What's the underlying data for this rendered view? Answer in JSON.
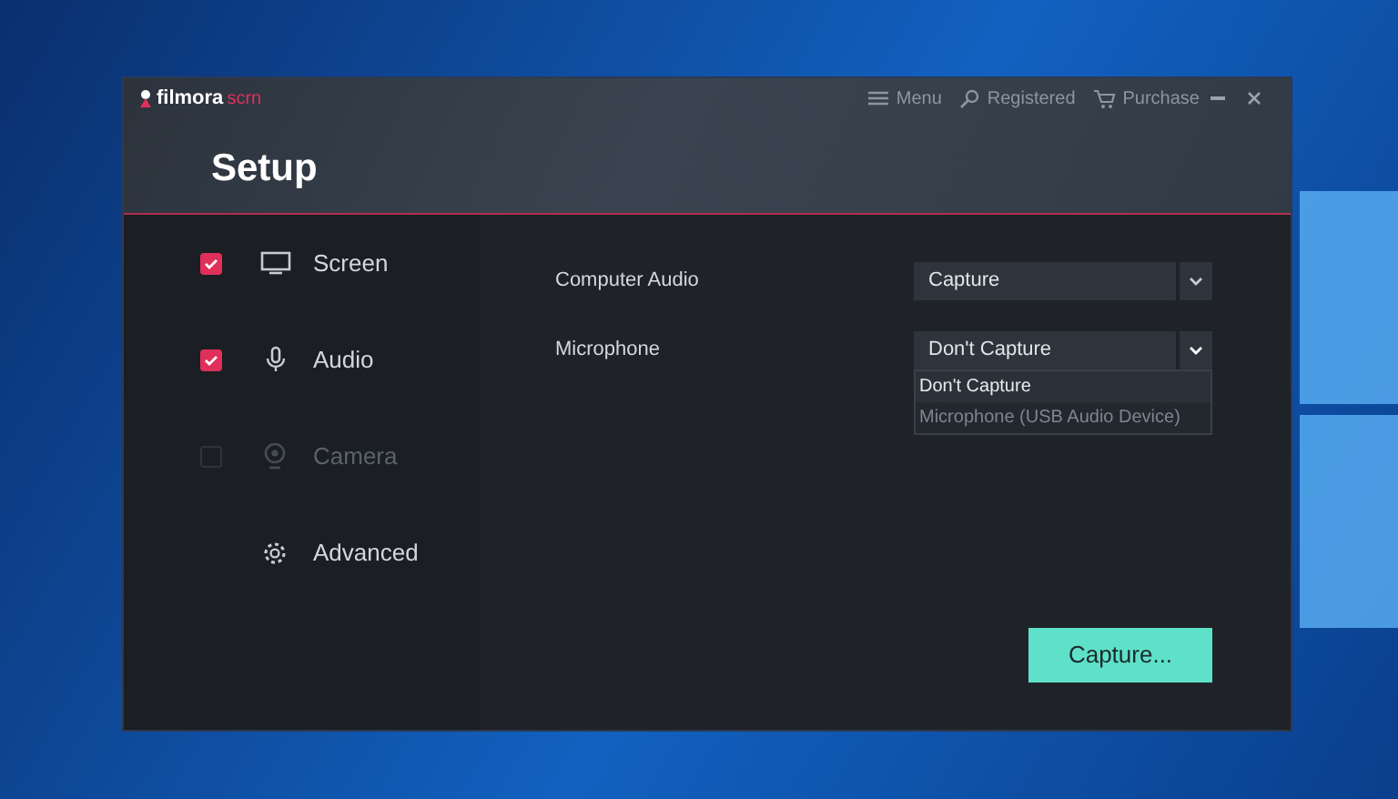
{
  "window": {
    "logo": "filmora",
    "logo_suffix": "scrn",
    "title": "Setup"
  },
  "header_actions": [
    {
      "kind": "menu",
      "label": "Menu"
    },
    {
      "kind": "key",
      "label": "Registered"
    },
    {
      "kind": "cart",
      "label": "Purchase"
    }
  ],
  "sidebar": {
    "items": [
      {
        "kind": "screen",
        "label": "Screen",
        "checked": true,
        "disabled": false
      },
      {
        "kind": "audio",
        "label": "Audio",
        "checked": true,
        "disabled": false
      },
      {
        "kind": "camera",
        "label": "Camera",
        "checked": false,
        "disabled": true
      },
      {
        "kind": "advanced",
        "label": "Advanced",
        "disabled": false
      }
    ]
  },
  "settings": [
    {
      "label": "Computer Audio",
      "value": "Capture",
      "expanded": false
    },
    {
      "label": "Microphone",
      "value": "Don't Capture",
      "expanded": true,
      "options": [
        {
          "label": "Don't Capture",
          "selected": true
        },
        {
          "label": "Microphone (USB Audio Device)",
          "selected": false
        }
      ]
    }
  ],
  "capture_button": "Capture..."
}
